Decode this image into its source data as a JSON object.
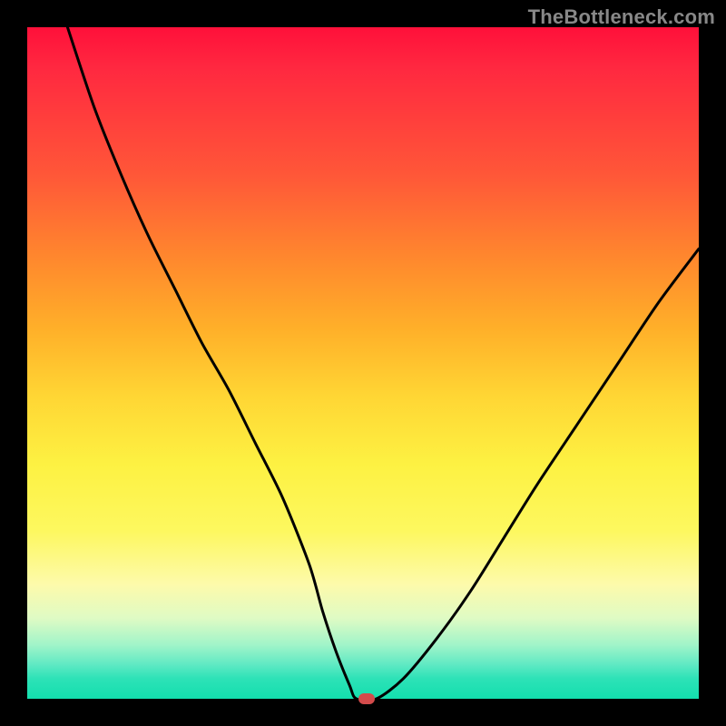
{
  "watermark": "TheBottleneck.com",
  "chart_data": {
    "type": "line",
    "title": "",
    "xlabel": "",
    "ylabel": "",
    "xlim": [
      0,
      100
    ],
    "ylim": [
      0,
      100
    ],
    "grid": false,
    "legend": false,
    "background_gradient": {
      "top": "#ff103a",
      "bottom": "#13dfae",
      "stops": [
        "red",
        "orange",
        "yellow",
        "green"
      ]
    },
    "series": [
      {
        "name": "bottleneck-curve",
        "x": [
          6,
          10,
          14,
          18,
          22,
          26,
          30,
          34,
          38,
          42,
          44,
          46,
          48,
          49,
          52,
          56,
          61,
          66,
          71,
          76,
          82,
          88,
          94,
          100
        ],
        "y": [
          100,
          88,
          78,
          69,
          61,
          53,
          46,
          38,
          30,
          20,
          13,
          7,
          2,
          0,
          0,
          3,
          9,
          16,
          24,
          32,
          41,
          50,
          59,
          67
        ],
        "color": "#000000",
        "linewidth": 3
      }
    ],
    "marker": {
      "name": "optimal-point",
      "x": 50.5,
      "y": 0,
      "color": "#d34b4b",
      "shape": "pill"
    }
  }
}
